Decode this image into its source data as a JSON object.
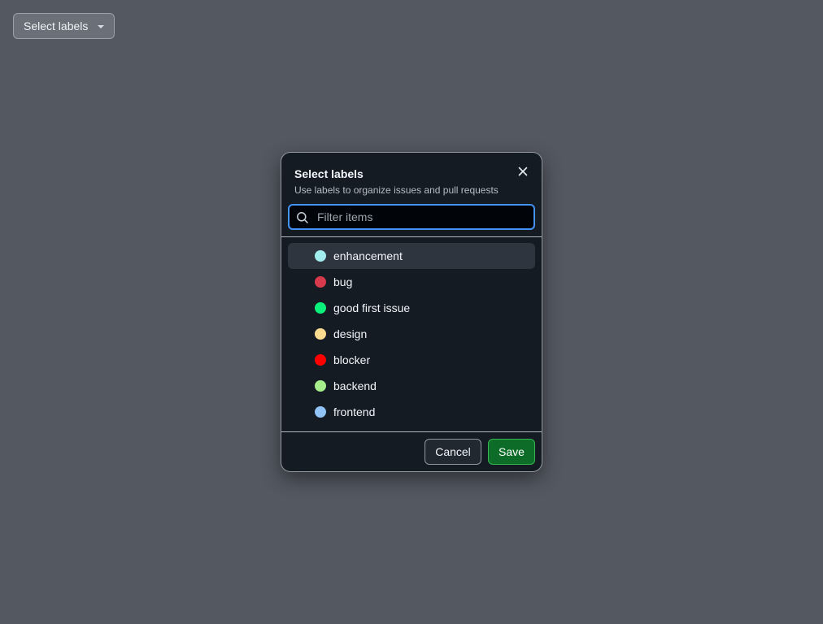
{
  "trigger": {
    "label": "Select labels",
    "icon": "triangle-down-icon"
  },
  "dialog": {
    "title": "Select labels",
    "subtitle": "Use labels to organize issues and pull requests",
    "close_icon": "x-icon",
    "search": {
      "placeholder": "Filter items",
      "value": "",
      "icon": "search-icon"
    },
    "items": [
      {
        "label": "enhancement",
        "color": "#a2eeef",
        "active": true
      },
      {
        "label": "bug",
        "color": "#d73a4a",
        "active": false
      },
      {
        "label": "good first issue",
        "color": "#0bf07a",
        "active": false
      },
      {
        "label": "design",
        "color": "#fbdb8f",
        "active": false
      },
      {
        "label": "blocker",
        "color": "#ff0000",
        "active": false
      },
      {
        "label": "backend",
        "color": "#a6ee8b",
        "active": false
      },
      {
        "label": "frontend",
        "color": "#91c3f6",
        "active": false
      }
    ],
    "cancel_label": "Cancel",
    "save_label": "Save"
  },
  "colors": {
    "backdrop": "#545861",
    "dialog_bg": "#151b23",
    "focus_ring": "#4493f8",
    "primary_button": "#0d6d28"
  }
}
